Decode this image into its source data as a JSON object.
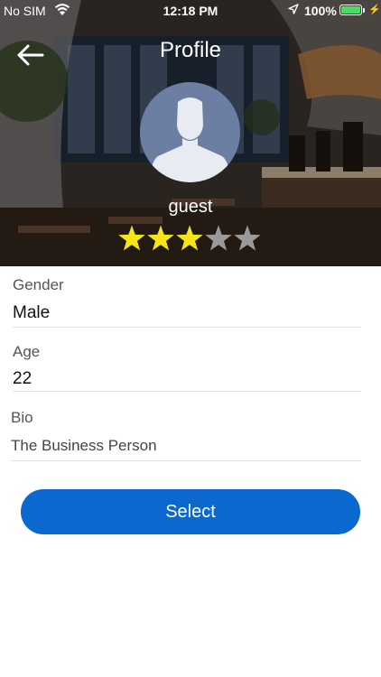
{
  "status_bar": {
    "carrier": "No SIM",
    "time": "12:18 PM",
    "battery": "100%"
  },
  "header": {
    "title": "Profile",
    "back_icon": "arrow-left-icon"
  },
  "profile": {
    "username": "guest",
    "avatar_icon": "user-silhouette-icon",
    "rating": 3,
    "rating_max": 5,
    "star_color_filled": "#f5e514",
    "star_color_empty": "#9a9a9a"
  },
  "fields": {
    "gender": {
      "label": "Gender",
      "value": "Male"
    },
    "age": {
      "label": "Age",
      "value": "22"
    },
    "bio": {
      "label": "Bio",
      "value": "The Business Person"
    }
  },
  "actions": {
    "select_label": "Select",
    "accent_color": "#0a68cf"
  }
}
